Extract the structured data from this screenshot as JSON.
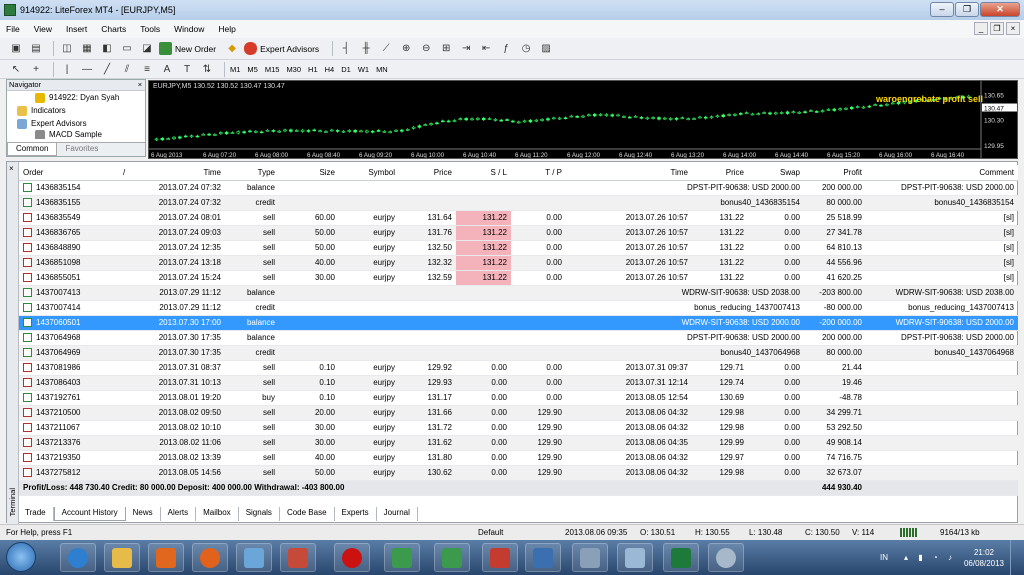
{
  "window": {
    "title": "914922: LiteForex MT4 - [EURJPY,M5]"
  },
  "menu": [
    "File",
    "View",
    "Insert",
    "Charts",
    "Tools",
    "Window",
    "Help"
  ],
  "toolbar": {
    "new_order": "New Order",
    "expert_advisors": "Expert Advisors",
    "timeframes": [
      "M1",
      "M5",
      "M15",
      "M30",
      "H1",
      "H4",
      "D1",
      "W1",
      "MN"
    ]
  },
  "navigator": {
    "title": "Navigator",
    "items": [
      "914922: Dyan Syah",
      "Indicators",
      "Expert Advisors",
      "MACD Sample"
    ],
    "tabs": [
      "Common",
      "Favorites"
    ]
  },
  "chart": {
    "header": "EURJPY,M5  130.52 130.52 130.47 130.47",
    "ea_label": "waroengrebate profit sell",
    "price_labels": [
      "130.65",
      "130.47",
      "130.30",
      "129.95"
    ],
    "time_labels": [
      "6 Aug 2013",
      "6 Aug 07:20",
      "6 Aug 08:00",
      "6 Aug 08:40",
      "6 Aug 09:20",
      "6 Aug 10:00",
      "6 Aug 10:40",
      "6 Aug 11:20",
      "6 Aug 12:00",
      "6 Aug 12:40",
      "6 Aug 13:20",
      "6 Aug 14:00",
      "6 Aug 14:40",
      "6 Aug 15:20",
      "6 Aug 16:00",
      "6 Aug 16:40"
    ]
  },
  "terminal": {
    "label": "Terminal",
    "columns": [
      "Order",
      "/",
      "Time",
      "Type",
      "Size",
      "Symbol",
      "Price",
      "S / L",
      "T / P",
      "Time",
      "Price",
      "Swap",
      "Profit",
      "Comment"
    ],
    "rows": [
      {
        "order": "1436835154",
        "time": "2013.07.24 07:32",
        "type": "balance",
        "size": "",
        "symbol": "",
        "price": "",
        "sl": "",
        "tp": "",
        "ctime": "DPST-PIT-90638: USD 2000.00",
        "cprice": "",
        "swap": "",
        "profit": "200 000.00",
        "comment": "DPST-PIT-90638: USD 2000.00"
      },
      {
        "order": "1436835155",
        "time": "2013.07.24 07:32",
        "type": "credit",
        "size": "",
        "symbol": "",
        "price": "",
        "sl": "",
        "tp": "",
        "ctime": "bonus40_1436835154",
        "cprice": "",
        "swap": "",
        "profit": "80 000.00",
        "comment": "bonus40_1436835154"
      },
      {
        "order": "1436835549",
        "time": "2013.07.24 08:01",
        "type": "sell",
        "size": "60.00",
        "symbol": "eurjpy",
        "price": "131.64",
        "sl": "131.22",
        "tp": "0.00",
        "ctime": "2013.07.26 10:57",
        "cprice": "131.22",
        "swap": "0.00",
        "profit": "25 518.99",
        "comment": "[sl]"
      },
      {
        "order": "1436836765",
        "time": "2013.07.24 09:03",
        "type": "sell",
        "size": "50.00",
        "symbol": "eurjpy",
        "price": "131.76",
        "sl": "131.22",
        "tp": "0.00",
        "ctime": "2013.07.26 10:57",
        "cprice": "131.22",
        "swap": "0.00",
        "profit": "27 341.78",
        "comment": "[sl]"
      },
      {
        "order": "1436848890",
        "time": "2013.07.24 12:35",
        "type": "sell",
        "size": "50.00",
        "symbol": "eurjpy",
        "price": "132.50",
        "sl": "131.22",
        "tp": "0.00",
        "ctime": "2013.07.26 10:57",
        "cprice": "131.22",
        "swap": "0.00",
        "profit": "64 810.13",
        "comment": "[sl]"
      },
      {
        "order": "1436851098",
        "time": "2013.07.24 13:18",
        "type": "sell",
        "size": "40.00",
        "symbol": "eurjpy",
        "price": "132.32",
        "sl": "131.22",
        "tp": "0.00",
        "ctime": "2013.07.26 10:57",
        "cprice": "131.22",
        "swap": "0.00",
        "profit": "44 556.96",
        "comment": "[sl]"
      },
      {
        "order": "1436855051",
        "time": "2013.07.24 15:24",
        "type": "sell",
        "size": "30.00",
        "symbol": "eurjpy",
        "price": "132.59",
        "sl": "131.22",
        "tp": "0.00",
        "ctime": "2013.07.26 10:57",
        "cprice": "131.22",
        "swap": "0.00",
        "profit": "41 620.25",
        "comment": "[sl]"
      },
      {
        "order": "1437007413",
        "time": "2013.07.29 11:12",
        "type": "balance",
        "size": "",
        "symbol": "",
        "price": "",
        "sl": "",
        "tp": "",
        "ctime": "WDRW-SIT-90638: USD 2038.00",
        "cprice": "",
        "swap": "",
        "profit": "-203 800.00",
        "comment": "WDRW-SIT-90638: USD 2038.00"
      },
      {
        "order": "1437007414",
        "time": "2013.07.29 11:12",
        "type": "credit",
        "size": "",
        "symbol": "",
        "price": "",
        "sl": "",
        "tp": "",
        "ctime": "bonus_reducing_1437007413",
        "cprice": "",
        "swap": "",
        "profit": "-80 000.00",
        "comment": "bonus_reducing_1437007413"
      },
      {
        "order": "1437060501",
        "time": "2013.07.30 17:00",
        "type": "balance",
        "size": "",
        "symbol": "",
        "price": "",
        "sl": "",
        "tp": "",
        "ctime": "WDRW-SIT-90638: USD 2000.00",
        "cprice": "",
        "swap": "",
        "profit": "-200 000.00",
        "comment": "WDRW-SIT-90638: USD 2000.00"
      },
      {
        "order": "1437064968",
        "time": "2013.07.30 17:35",
        "type": "balance",
        "size": "",
        "symbol": "",
        "price": "",
        "sl": "",
        "tp": "",
        "ctime": "DPST-PIT-90638: USD 2000.00",
        "cprice": "",
        "swap": "",
        "profit": "200 000.00",
        "comment": "DPST-PIT-90638: USD 2000.00"
      },
      {
        "order": "1437064969",
        "time": "2013.07.30 17:35",
        "type": "credit",
        "size": "",
        "symbol": "",
        "price": "",
        "sl": "",
        "tp": "",
        "ctime": "bonus40_1437064968",
        "cprice": "",
        "swap": "",
        "profit": "80 000.00",
        "comment": "bonus40_1437064968"
      },
      {
        "order": "1437081986",
        "time": "2013.07.31 08:37",
        "type": "sell",
        "size": "0.10",
        "symbol": "eurjpy",
        "price": "129.92",
        "sl": "0.00",
        "tp": "0.00",
        "ctime": "2013.07.31 09:37",
        "cprice": "129.71",
        "swap": "0.00",
        "profit": "21.44",
        "comment": ""
      },
      {
        "order": "1437086403",
        "time": "2013.07.31 10:13",
        "type": "sell",
        "size": "0.10",
        "symbol": "eurjpy",
        "price": "129.93",
        "sl": "0.00",
        "tp": "0.00",
        "ctime": "2013.07.31 12:14",
        "cprice": "129.74",
        "swap": "0.00",
        "profit": "19.46",
        "comment": ""
      },
      {
        "order": "1437192761",
        "time": "2013.08.01 19:20",
        "type": "buy",
        "size": "0.10",
        "symbol": "eurjpy",
        "price": "131.17",
        "sl": "0.00",
        "tp": "0.00",
        "ctime": "2013.08.05 12:54",
        "cprice": "130.69",
        "swap": "0.00",
        "profit": "-48.78",
        "comment": ""
      },
      {
        "order": "1437210500",
        "time": "2013.08.02 09:50",
        "type": "sell",
        "size": "20.00",
        "symbol": "eurjpy",
        "price": "131.66",
        "sl": "0.00",
        "tp": "129.90",
        "ctime": "2013.08.06 04:32",
        "cprice": "129.98",
        "swap": "0.00",
        "profit": "34 299.71",
        "comment": ""
      },
      {
        "order": "1437211067",
        "time": "2013.08.02 10:10",
        "type": "sell",
        "size": "30.00",
        "symbol": "eurjpy",
        "price": "131.72",
        "sl": "0.00",
        "tp": "129.90",
        "ctime": "2013.08.06 04:32",
        "cprice": "129.98",
        "swap": "0.00",
        "profit": "53 292.50",
        "comment": ""
      },
      {
        "order": "1437213376",
        "time": "2013.08.02 11:06",
        "type": "sell",
        "size": "30.00",
        "symbol": "eurjpy",
        "price": "131.62",
        "sl": "0.00",
        "tp": "129.90",
        "ctime": "2013.08.06 04:35",
        "cprice": "129.99",
        "swap": "0.00",
        "profit": "49 908.14",
        "comment": ""
      },
      {
        "order": "1437219350",
        "time": "2013.08.02 13:39",
        "type": "sell",
        "size": "40.00",
        "symbol": "eurjpy",
        "price": "131.80",
        "sl": "0.00",
        "tp": "129.90",
        "ctime": "2013.08.06 04:32",
        "cprice": "129.97",
        "swap": "0.00",
        "profit": "74 716.75",
        "comment": ""
      },
      {
        "order": "1437275812",
        "time": "2013.08.05 14:56",
        "type": "sell",
        "size": "50.00",
        "symbol": "eurjpy",
        "price": "130.62",
        "sl": "0.00",
        "tp": "129.90",
        "ctime": "2013.08.06 04:32",
        "cprice": "129.98",
        "swap": "0.00",
        "profit": "32 673.07",
        "comment": ""
      }
    ],
    "summary": "Profit/Loss: 448 730.40  Credit: 80 000.00  Deposit: 400 000.00  Withdrawal: -403 800.00",
    "summary_profit": "444 930.40",
    "tabs": [
      "Trade",
      "Account History",
      "News",
      "Alerts",
      "Mailbox",
      "Signals",
      "Code Base",
      "Experts",
      "Journal"
    ]
  },
  "status": {
    "help": "For Help, press F1",
    "profile": "Default",
    "time": "2013.08.06 09:35",
    "open": "O: 130.51",
    "high": "H: 130.55",
    "low": "L: 130.48",
    "close": "C: 130.50",
    "volume": "V: 114",
    "traffic": "9164/13 kb"
  },
  "taskbar": {
    "lang": "IN",
    "time": "21:02",
    "date": "06/08/2013"
  },
  "colors": {
    "selection": "#3399ff",
    "sl_hit": "#f4b3ba",
    "chart_bg": "#000000",
    "candles": "#33ff66"
  }
}
